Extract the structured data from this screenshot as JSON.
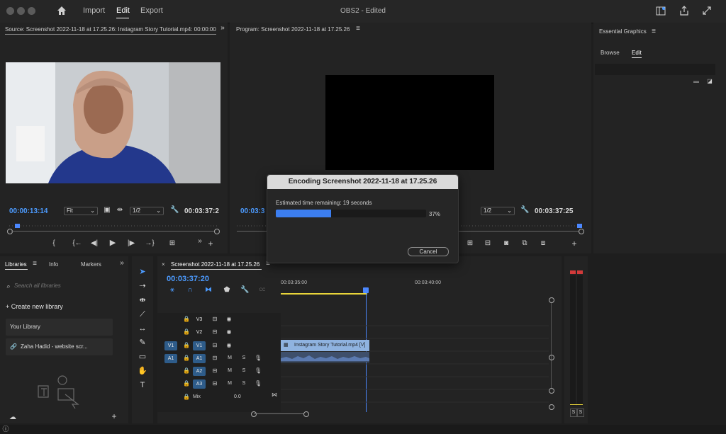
{
  "app": {
    "nav": {
      "import": "Import",
      "edit": "Edit",
      "export": "Export"
    },
    "project_title": "OBS2 - Edited"
  },
  "source_monitor": {
    "title": "Source: Screenshot 2022-11-18 at 17.25.26: Instagram Story Tutorial.mp4: 00:00:00",
    "timecode": "00:00:13:14",
    "fit": "Fit",
    "resolution": "1/2",
    "duration": "00:03:37:2"
  },
  "program_monitor": {
    "title": "Program: Screenshot 2022-11-18 at 17.25.26",
    "timecode_partial": "00:03:3",
    "resolution": "1/2",
    "duration": "00:03:37:25"
  },
  "essential_graphics": {
    "title": "Essential Graphics",
    "tabs": {
      "browse": "Browse",
      "edit": "Edit"
    }
  },
  "encoding_dialog": {
    "title": "Encoding Screenshot 2022-11-18 at 17.25.26",
    "estimate": "Estimated time remaining: 19 seconds",
    "percent_label": "37%",
    "progress": 0.37,
    "cancel": "Cancel"
  },
  "libraries": {
    "tabs": {
      "libraries": "Libraries",
      "info": "Info",
      "markers": "Markers"
    },
    "search_placeholder": "Search all libraries",
    "create": "Create new library",
    "items": [
      "Your Library",
      "Zaha Hadid - website scr..."
    ]
  },
  "timeline": {
    "sequence": "Screenshot 2022-11-18 at 17.25.26",
    "timecode": "00:03:37:20",
    "ruler": [
      "00:03:35:00",
      "00:03:40:00"
    ],
    "video_tracks": [
      "V3",
      "V2",
      "V1"
    ],
    "audio_tracks": [
      "A1",
      "A2",
      "A3"
    ],
    "source_v": "V1",
    "source_a": "A1",
    "m": "M",
    "s": "S",
    "mix": "Mix",
    "mix_value": "0.0",
    "clip": "Instagram Story Tutorial.mp4 [V]"
  },
  "meter": {
    "s1": "S",
    "s2": "S"
  },
  "colors": {
    "accent": "#4c9bff",
    "timeline_clip": "#8fb3e0",
    "playhead": "#4c88ff"
  }
}
